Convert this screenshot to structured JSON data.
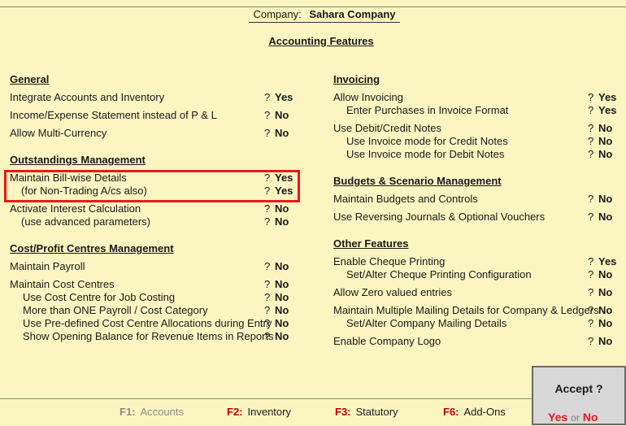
{
  "header": {
    "company_label": "Company:",
    "company_name": "Sahara Company",
    "screen_title": "Accounting Features"
  },
  "left": {
    "general": {
      "heading": "General",
      "items": [
        {
          "label": "Integrate Accounts and Inventory",
          "value": "Yes"
        },
        {
          "label": "Income/Expense Statement instead of P & L",
          "value": "No"
        },
        {
          "label": "Allow Multi-Currency",
          "value": "No"
        }
      ]
    },
    "outstandings": {
      "heading": "Outstandings Management",
      "items": [
        {
          "label": "Maintain Bill-wise Details",
          "value": "Yes"
        },
        {
          "label": "(for Non-Trading A/cs also)",
          "value": "Yes"
        },
        {
          "label": "Activate Interest Calculation",
          "value": "No"
        },
        {
          "label": "(use advanced parameters)",
          "value": "No"
        }
      ]
    },
    "cost": {
      "heading": "Cost/Profit Centres Management",
      "items": [
        {
          "label": "Maintain Payroll",
          "value": "No"
        },
        {
          "label": "Maintain Cost Centres",
          "value": "No"
        },
        {
          "label": "Use Cost Centre for Job Costing",
          "value": "No"
        },
        {
          "label": "More than ONE Payroll / Cost Category",
          "value": "No"
        },
        {
          "label": "Use Pre-defined Cost Centre Allocations during Entry",
          "value": "No"
        },
        {
          "label": "Show Opening Balance for Revenue Items in Reports",
          "value": "No"
        }
      ]
    }
  },
  "right": {
    "invoicing": {
      "heading": "Invoicing",
      "items": [
        {
          "label": "Allow Invoicing",
          "value": "Yes"
        },
        {
          "label": "Enter Purchases in Invoice Format",
          "value": "Yes"
        },
        {
          "label": "Use Debit/Credit Notes",
          "value": "No"
        },
        {
          "label": "Use Invoice mode for Credit Notes",
          "value": "No"
        },
        {
          "label": "Use Invoice mode for Debit Notes",
          "value": "No"
        }
      ]
    },
    "budgets": {
      "heading": "Budgets & Scenario Management",
      "items": [
        {
          "label": "Maintain Budgets and Controls",
          "value": "No"
        },
        {
          "label": "Use Reversing Journals & Optional Vouchers",
          "value": "No"
        }
      ]
    },
    "other": {
      "heading": "Other Features",
      "items": [
        {
          "label": "Enable Cheque Printing",
          "value": "Yes"
        },
        {
          "label": "Set/Alter Cheque Printing Configuration",
          "value": "No"
        },
        {
          "label": "Allow Zero valued entries",
          "value": "No"
        },
        {
          "label": "Maintain Multiple Mailing Details for Company & Ledgers",
          "value": "No"
        },
        {
          "label": "Set/Alter Company Mailing Details",
          "value": "No"
        },
        {
          "label": "Enable Company Logo",
          "value": "No"
        }
      ]
    }
  },
  "question_mark": "?",
  "accept_dialog": {
    "title": "Accept ?",
    "yes": "Yes",
    "or": "or",
    "no": "No"
  },
  "footer": {
    "keys": [
      {
        "key": "F1:",
        "text": "Accounts",
        "enabled": false
      },
      {
        "key": "F2:",
        "text": "Inventory",
        "enabled": true
      },
      {
        "key": "F3:",
        "text": "Statutory",
        "enabled": true
      },
      {
        "key": "F6:",
        "text": "Add-Ons",
        "enabled": true
      }
    ]
  },
  "colors": {
    "background": "#fbf5c1",
    "highlight_border": "#e8191c",
    "fkey": "#c00000"
  }
}
